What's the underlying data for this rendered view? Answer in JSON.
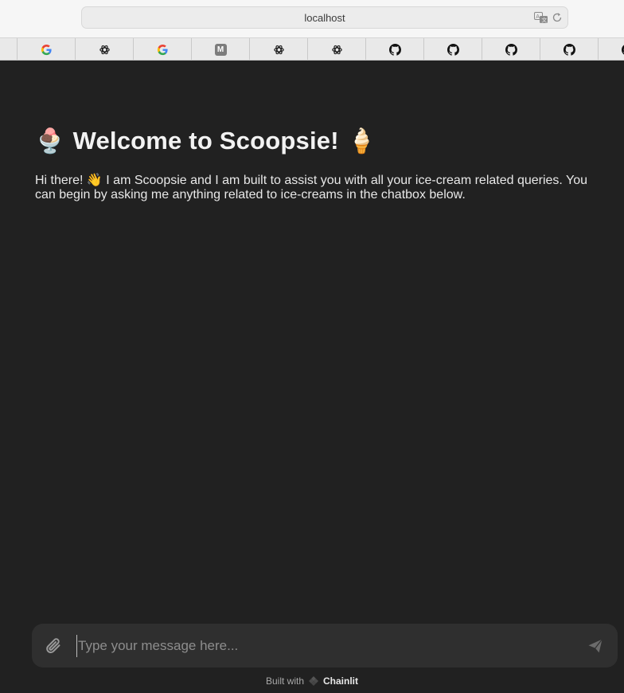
{
  "browser": {
    "url": "localhost",
    "tabs": [
      {
        "icon": "google-icon"
      },
      {
        "icon": "chatgpt-icon"
      },
      {
        "icon": "google-icon"
      },
      {
        "icon": "medium-icon",
        "glyph": "M"
      },
      {
        "icon": "chatgpt-icon"
      },
      {
        "icon": "chatgpt-icon"
      },
      {
        "icon": "github-icon"
      },
      {
        "icon": "github-icon"
      },
      {
        "icon": "github-icon"
      },
      {
        "icon": "github-icon"
      },
      {
        "icon": "github-icon"
      }
    ]
  },
  "welcome": {
    "emoji_left": "🍨",
    "title": "Welcome to Scoopsie!",
    "emoji_right": "🍦",
    "message": "Hi there! 👋 I am Scoopsie and I am built to assist you with all your ice-cream related queries. You can begin by asking me anything related to ice-creams in the chatbox below."
  },
  "composer": {
    "placeholder": "Type your message here...",
    "value": ""
  },
  "footer": {
    "built_with": "Built with",
    "brand": "Chainlit"
  },
  "colors": {
    "background": "#212121",
    "composer": "#2f2f2f",
    "text": "#f2f2f2"
  }
}
